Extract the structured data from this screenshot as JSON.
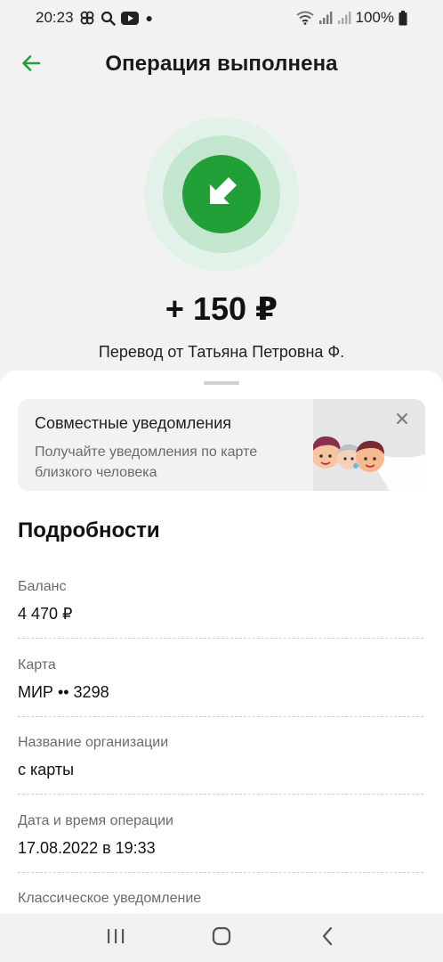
{
  "status_bar": {
    "time": "20:23",
    "battery": "100%",
    "icons": [
      "pinwheel-icon",
      "search-icon",
      "youtube-icon",
      "notification-dot-icon",
      "wifi-icon",
      "signal-icon",
      "signal-icon",
      "battery-icon"
    ]
  },
  "header": {
    "title": "Операция выполнена",
    "back_icon": "arrow-left-icon"
  },
  "transfer": {
    "icon": "incoming-arrow-icon",
    "amount": "+ 150 ₽",
    "description": "Перевод от Татьяна Петровна Ф."
  },
  "promo": {
    "title": "Совместные уведомления",
    "subtitle": "Получайте уведомления по карте близкого человека",
    "close_icon": "close-icon"
  },
  "details": {
    "title": "Подробности",
    "items": [
      {
        "label": "Баланс",
        "value": "4 470 ₽"
      },
      {
        "label": "Карта",
        "value": "МИР •• 3298"
      },
      {
        "label": "Название организации",
        "value": "с карты"
      },
      {
        "label": "Дата и время операции",
        "value": "17.08.2022 в 19:33"
      }
    ],
    "last_label": "Классическое уведомление"
  },
  "nav": {
    "icons": [
      "recent-apps-icon",
      "home-icon",
      "back-icon"
    ]
  },
  "colors": {
    "accent": "#21a038",
    "halo_outer": "#e3f2e8",
    "halo_mid": "#c3e6cf",
    "background": "#f2f2f2"
  }
}
